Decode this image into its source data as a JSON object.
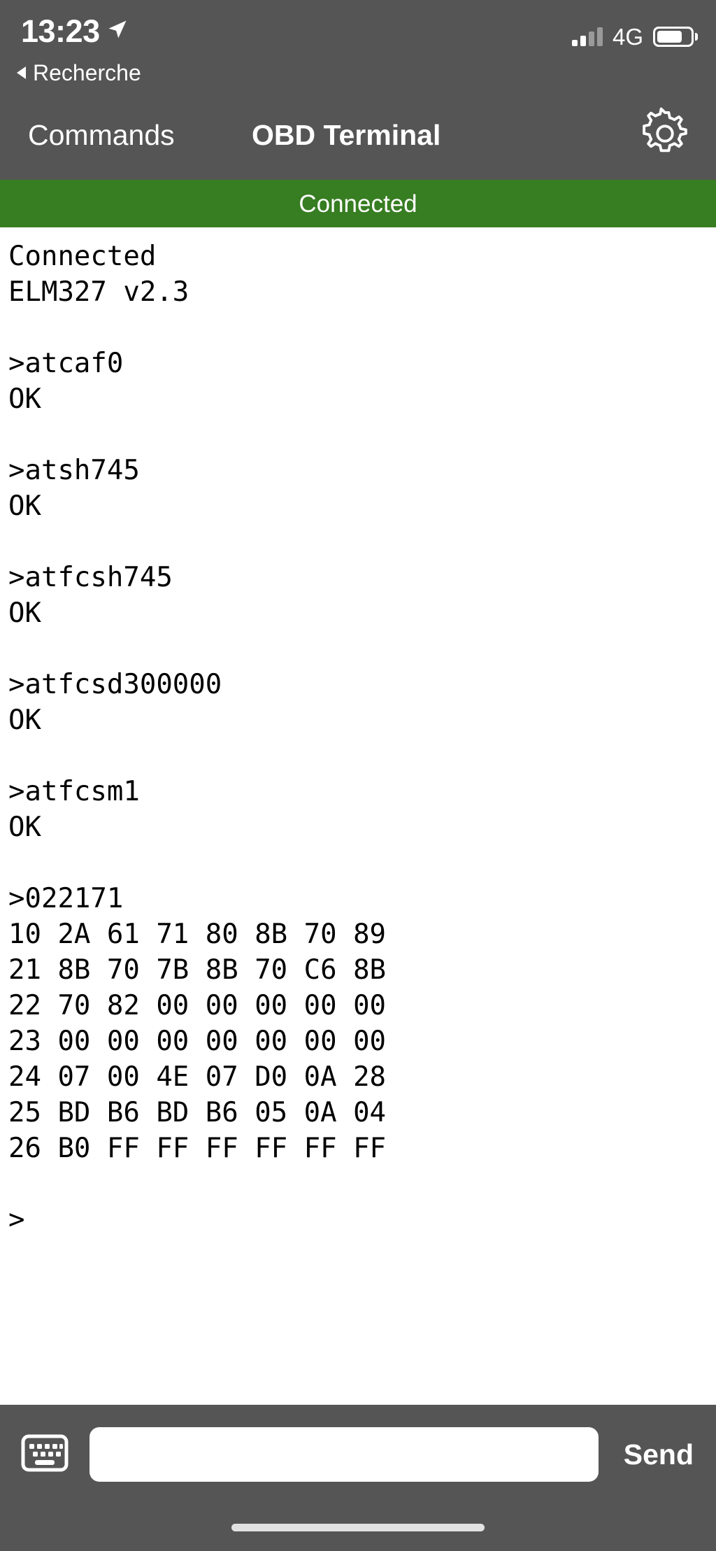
{
  "status_bar": {
    "time": "13:23",
    "location_icon": "location-arrow-icon",
    "network_label": "4G",
    "signal_icon": "signal-bars-icon",
    "battery_icon": "battery-icon",
    "battery_level_percent": 75,
    "back_label": "Recherche",
    "back_icon": "back-caret-icon"
  },
  "nav_bar": {
    "left_button": "Commands",
    "title": "OBD Terminal",
    "settings_icon": "gear-icon"
  },
  "connection_banner": {
    "label": "Connected",
    "color": "#377d22"
  },
  "terminal": {
    "lines": [
      "Connected",
      "ELM327 v2.3",
      "",
      ">atcaf0",
      "OK",
      "",
      ">atsh745",
      "OK",
      "",
      ">atfcsh745",
      "OK",
      "",
      ">atfcsd300000",
      "OK",
      "",
      ">atfcsm1",
      "OK",
      "",
      ">022171",
      "10 2A 61 71 80 8B 70 89",
      "21 8B 70 7B 8B 70 C6 8B",
      "22 70 82 00 00 00 00 00",
      "23 00 00 00 00 00 00 00",
      "24 07 00 4E 07 D0 0A 28",
      "25 BD B6 BD B6 05 0A 04",
      "26 B0 FF FF FF FF FF FF",
      "",
      ">"
    ]
  },
  "input_bar": {
    "keyboard_icon": "keyboard-icon",
    "input_value": "",
    "input_placeholder": "",
    "send_label": "Send"
  },
  "home_indicator": {
    "icon": "home-indicator-bar"
  }
}
